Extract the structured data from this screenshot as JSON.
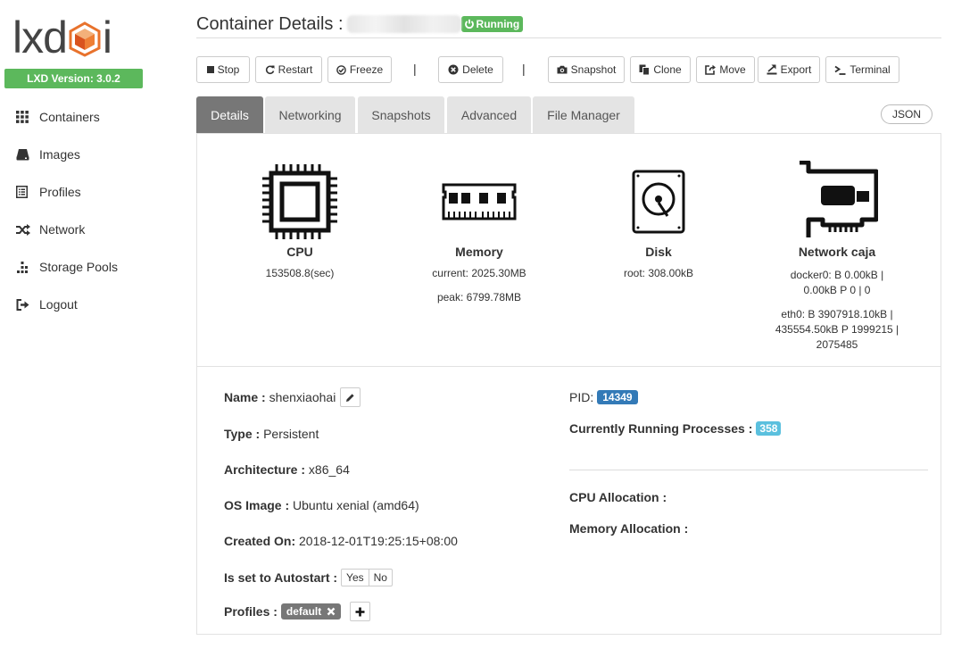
{
  "brand": {
    "logo_text_left": "lxd",
    "logo_text_right": "i",
    "version_label": "LXD Version: 3.0.2",
    "accent": "#5cb85c"
  },
  "sidebar": {
    "items": [
      {
        "label": "Containers",
        "icon": "grid-icon"
      },
      {
        "label": "Images",
        "icon": "drive-icon"
      },
      {
        "label": "Profiles",
        "icon": "list-icon"
      },
      {
        "label": "Network",
        "icon": "shuffle-icon"
      },
      {
        "label": "Storage Pools",
        "icon": "tasks-icon"
      },
      {
        "label": "Logout",
        "icon": "logout-icon"
      }
    ]
  },
  "header": {
    "title": "Container Details :",
    "status": "Running"
  },
  "toolbar": {
    "stop": "Stop",
    "restart": "Restart",
    "freeze": "Freeze",
    "delete": "Delete",
    "snapshot": "Snapshot",
    "clone": "Clone",
    "move": "Move",
    "export": "Export",
    "terminal": "Terminal",
    "separator": "|"
  },
  "tabs": [
    {
      "label": "Details",
      "active": true
    },
    {
      "label": "Networking",
      "active": false
    },
    {
      "label": "Snapshots",
      "active": false
    },
    {
      "label": "Advanced",
      "active": false
    },
    {
      "label": "File Manager",
      "active": false
    }
  ],
  "json_button": "JSON",
  "stats": {
    "cpu": {
      "label": "CPU",
      "value": "153508.8(sec)"
    },
    "memory": {
      "label": "Memory",
      "current": "current: 2025.30MB",
      "peak": "peak: 6799.78MB"
    },
    "disk": {
      "label": "Disk",
      "root": "root: 308.00kB"
    },
    "network": {
      "label": "Network caja",
      "docker0_a": "docker0: B 0.00kB |",
      "docker0_b": "0.00kB P 0 | 0",
      "eth0_a": "eth0: B 3907918.10kB |",
      "eth0_b": "435554.50kB P 1999215 |",
      "eth0_c": "2075485"
    }
  },
  "details": {
    "name_label": "Name :",
    "name": "shenxiaohai",
    "type_label": "Type :",
    "type": "Persistent",
    "arch_label": "Architecture :",
    "arch": "x86_64",
    "os_label": "OS Image :",
    "os": "Ubuntu xenial (amd64)",
    "created_label": "Created On:",
    "created": "2018-12-01T19:25:15+08:00",
    "autostart_label": "Is set to Autostart :",
    "autostart_yes": "Yes",
    "autostart_no": "No",
    "profiles_label": "Profiles :",
    "profile": "default",
    "pid_label": "PID:",
    "pid": "14349",
    "processes_label": "Currently Running Processes :",
    "processes": "358",
    "cpu_alloc_label": "CPU Allocation :",
    "mem_alloc_label": "Memory Allocation :"
  }
}
